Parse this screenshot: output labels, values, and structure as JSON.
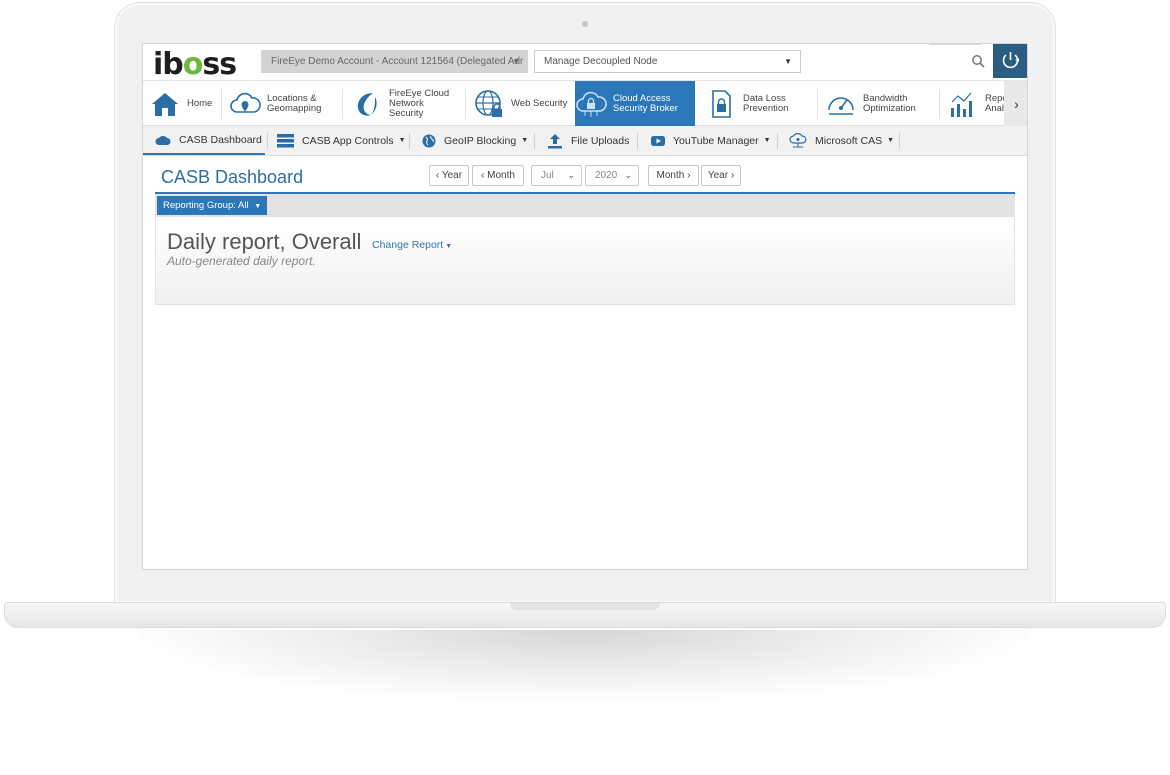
{
  "brand": {
    "logo_text_1": "ib",
    "logo_text_2": "o",
    "logo_text_3": "ss",
    "accent": "#2b77b9",
    "brand_green": "#6bb93b"
  },
  "topbar": {
    "account_selector": "FireEye Demo Account - Account 121564 (Delegated Adr",
    "node_selector": "Manage Decoupled Node"
  },
  "main_nav": {
    "items": [
      {
        "label": "Home",
        "icon": "home-icon"
      },
      {
        "label": "Locations &\nGeomapping",
        "icon": "cloud-pin-icon"
      },
      {
        "label": "FireEye Cloud\nNetwork\nSecurity",
        "icon": "fireeye-icon"
      },
      {
        "label": "Web Security",
        "icon": "globe-lock-icon"
      },
      {
        "label": "Cloud Access\nSecurity Broker",
        "icon": "cloud-lock-icon",
        "active": true
      },
      {
        "label": "Data Loss\nPrevention",
        "icon": "document-lock-icon"
      },
      {
        "label": "Bandwidth\nOptimization",
        "icon": "gauge-icon"
      },
      {
        "label": "Repo\nAnaly",
        "icon": "chart-icon"
      }
    ]
  },
  "sub_nav": {
    "items": [
      {
        "label": "CASB Dashboard",
        "icon": "cloud-icon",
        "active": true
      },
      {
        "label": "CASB App Controls",
        "icon": "server-icon"
      },
      {
        "label": "GeoIP Blocking",
        "icon": "globe-icon"
      },
      {
        "label": "File Uploads",
        "icon": "upload-icon"
      },
      {
        "label": "YouTube Manager",
        "icon": "youtube-icon"
      },
      {
        "label": "Microsoft CAS",
        "icon": "cloud-network-icon"
      }
    ]
  },
  "page": {
    "title": "CASB Dashboard",
    "date_nav": {
      "prev_year": "Year",
      "prev_month": "Month",
      "month_value": "Jul",
      "year_value": "2020",
      "next_month": "Month",
      "next_year": "Year"
    },
    "reporting_group": "Reporting Group: All",
    "report": {
      "title": "Daily report, Overall",
      "change_label": "Change Report",
      "subtitle": "Auto-generated daily report."
    }
  }
}
